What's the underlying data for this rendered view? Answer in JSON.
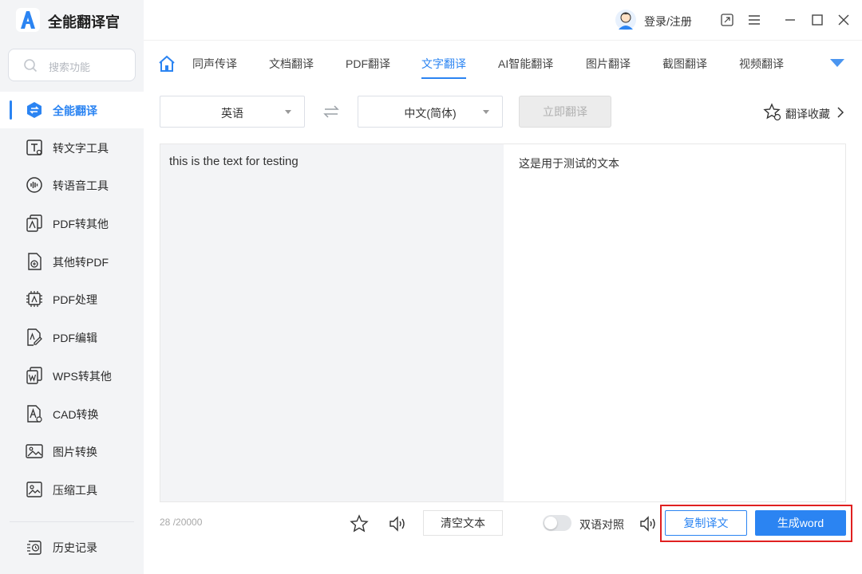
{
  "app": {
    "title": "全能翻译官",
    "accent": "#2b84f2"
  },
  "search": {
    "placeholder": "搜索功能"
  },
  "sidebar": {
    "items": [
      {
        "label": "全能翻译",
        "icon": "translate-icon",
        "active": true
      },
      {
        "label": "转文字工具",
        "icon": "text-tool-icon"
      },
      {
        "label": "转语音工具",
        "icon": "voice-tool-icon"
      },
      {
        "label": "PDF转其他",
        "icon": "pdf-convert-icon"
      },
      {
        "label": "其他转PDF",
        "icon": "to-pdf-icon"
      },
      {
        "label": "PDF处理",
        "icon": "pdf-process-icon"
      },
      {
        "label": "PDF编辑",
        "icon": "pdf-edit-icon"
      },
      {
        "label": "WPS转其他",
        "icon": "wps-convert-icon"
      },
      {
        "label": "CAD转换",
        "icon": "cad-convert-icon"
      },
      {
        "label": "图片转换",
        "icon": "image-convert-icon"
      },
      {
        "label": "压缩工具",
        "icon": "compress-icon"
      }
    ],
    "history": {
      "label": "历史记录",
      "icon": "history-icon"
    }
  },
  "header": {
    "login_label": "登录/注册"
  },
  "tabs": [
    {
      "label": "同声传译"
    },
    {
      "label": "文档翻译"
    },
    {
      "label": "PDF翻译"
    },
    {
      "label": "文字翻译",
      "active": true
    },
    {
      "label": "AI智能翻译"
    },
    {
      "label": "图片翻译"
    },
    {
      "label": "截图翻译"
    },
    {
      "label": "视频翻译"
    }
  ],
  "translate": {
    "source_lang": "英语",
    "target_lang": "中文(简体)",
    "translate_button": "立即翻译",
    "favorites_label": "翻译收藏",
    "source_text": "this is the text for testing",
    "target_text": "这是用于测试的文本"
  },
  "footer": {
    "char_count": "28",
    "char_limit": " /20000",
    "clear_label": "清空文本",
    "bilingual_label": "双语对照",
    "bilingual_on": false,
    "copy_label": "复制译文",
    "word_label": "生成word"
  }
}
